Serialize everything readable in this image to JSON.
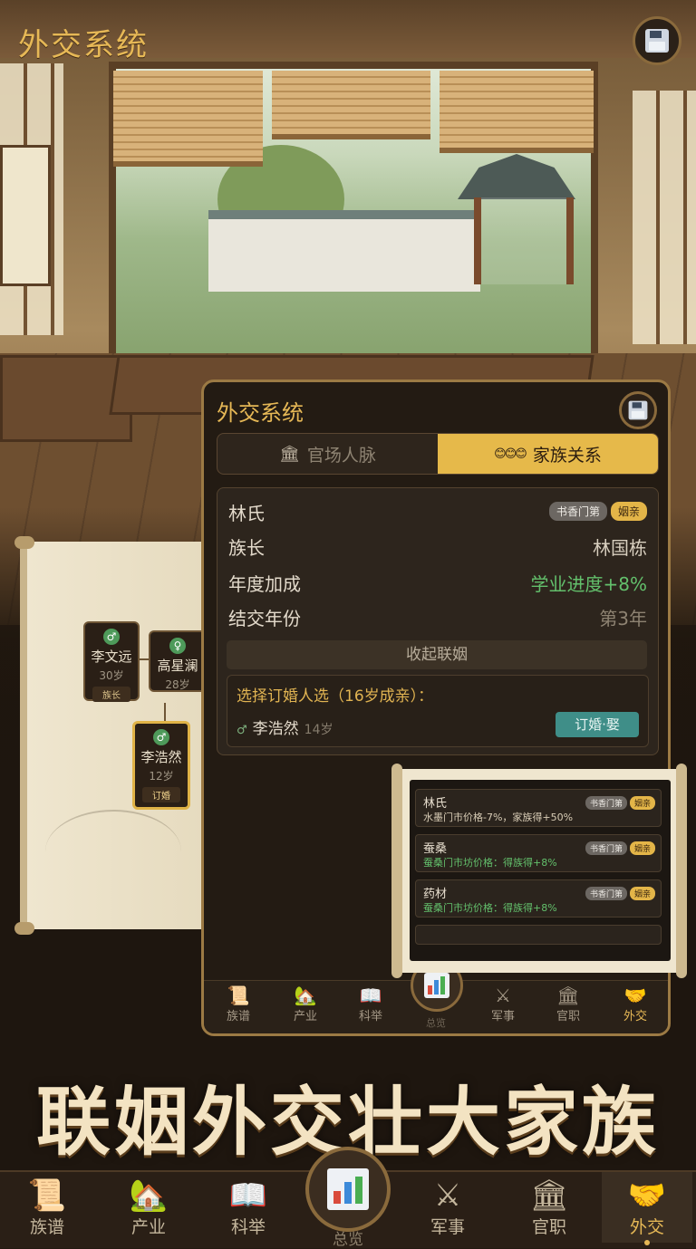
{
  "app": {
    "title": "外交系统"
  },
  "panel": {
    "title": "外交系统",
    "tabs": [
      {
        "label": "官场人脉",
        "icon": "government-icon",
        "active": false
      },
      {
        "label": "家族关系",
        "icon": "family-faces-icon",
        "active": true
      }
    ],
    "clan": {
      "name": "林氏",
      "badges": [
        "书香门第",
        "姻亲"
      ],
      "rows": [
        {
          "label": "族长",
          "value": "林国栋"
        },
        {
          "label": "年度加成",
          "value": "学业进度+8%"
        },
        {
          "label": "结交年份",
          "value": "第3年"
        }
      ],
      "fold_label": "收起联姻",
      "candidate_title": "选择订婚人选（16岁成亲）：",
      "candidate": {
        "name": "李浩然",
        "age": "14岁",
        "symbol": "♂"
      },
      "engage_label": "订婚·娶"
    }
  },
  "family_tree": {
    "nodes": [
      {
        "name": "李文远",
        "age": "30岁",
        "tag": "族长",
        "icon": "♂"
      },
      {
        "name": "高星澜",
        "age": "28岁",
        "icon": "♀"
      },
      {
        "name": "李浩然",
        "age": "12岁",
        "tag": "订婚",
        "icon": "♂",
        "selected": true
      }
    ]
  },
  "mini_list": [
    {
      "name": "林氏",
      "badges": [
        "书香门第",
        "姻亲"
      ],
      "desc": "水墨门市价格-7%，家族得+50%",
      "color": "#d9cdb6"
    },
    {
      "name": "蚕桑",
      "badges": [
        "书香门第",
        "姻亲"
      ],
      "desc": "蚕桑门市坊价格：得族得+8%",
      "color": "#63c06c"
    },
    {
      "name": "药材",
      "badges": [
        "书香门第",
        "姻亲"
      ],
      "desc": "蚕桑门市坊价格：得族得+8%",
      "color": "#63c06c"
    }
  ],
  "inner_nav": [
    "族谱",
    "产业",
    "科举",
    "总览",
    "军事",
    "官职",
    "外交"
  ],
  "banner": "联姻外交壮大家族",
  "bottom_nav": [
    {
      "label": "族谱",
      "icon": "scroll-icon"
    },
    {
      "label": "产业",
      "icon": "house-icon"
    },
    {
      "label": "科举",
      "icon": "book-icon"
    },
    {
      "label": "总览",
      "icon": "chart-icon"
    },
    {
      "label": "军事",
      "icon": "swords-icon"
    },
    {
      "label": "官职",
      "icon": "government-icon"
    },
    {
      "label": "外交",
      "icon": "handshake-icon",
      "active": true
    }
  ],
  "colors": {
    "accent": "#e6b856",
    "active_tab": "#e6b94a",
    "positive": "#63c06c",
    "engage": "#3f8e88"
  }
}
